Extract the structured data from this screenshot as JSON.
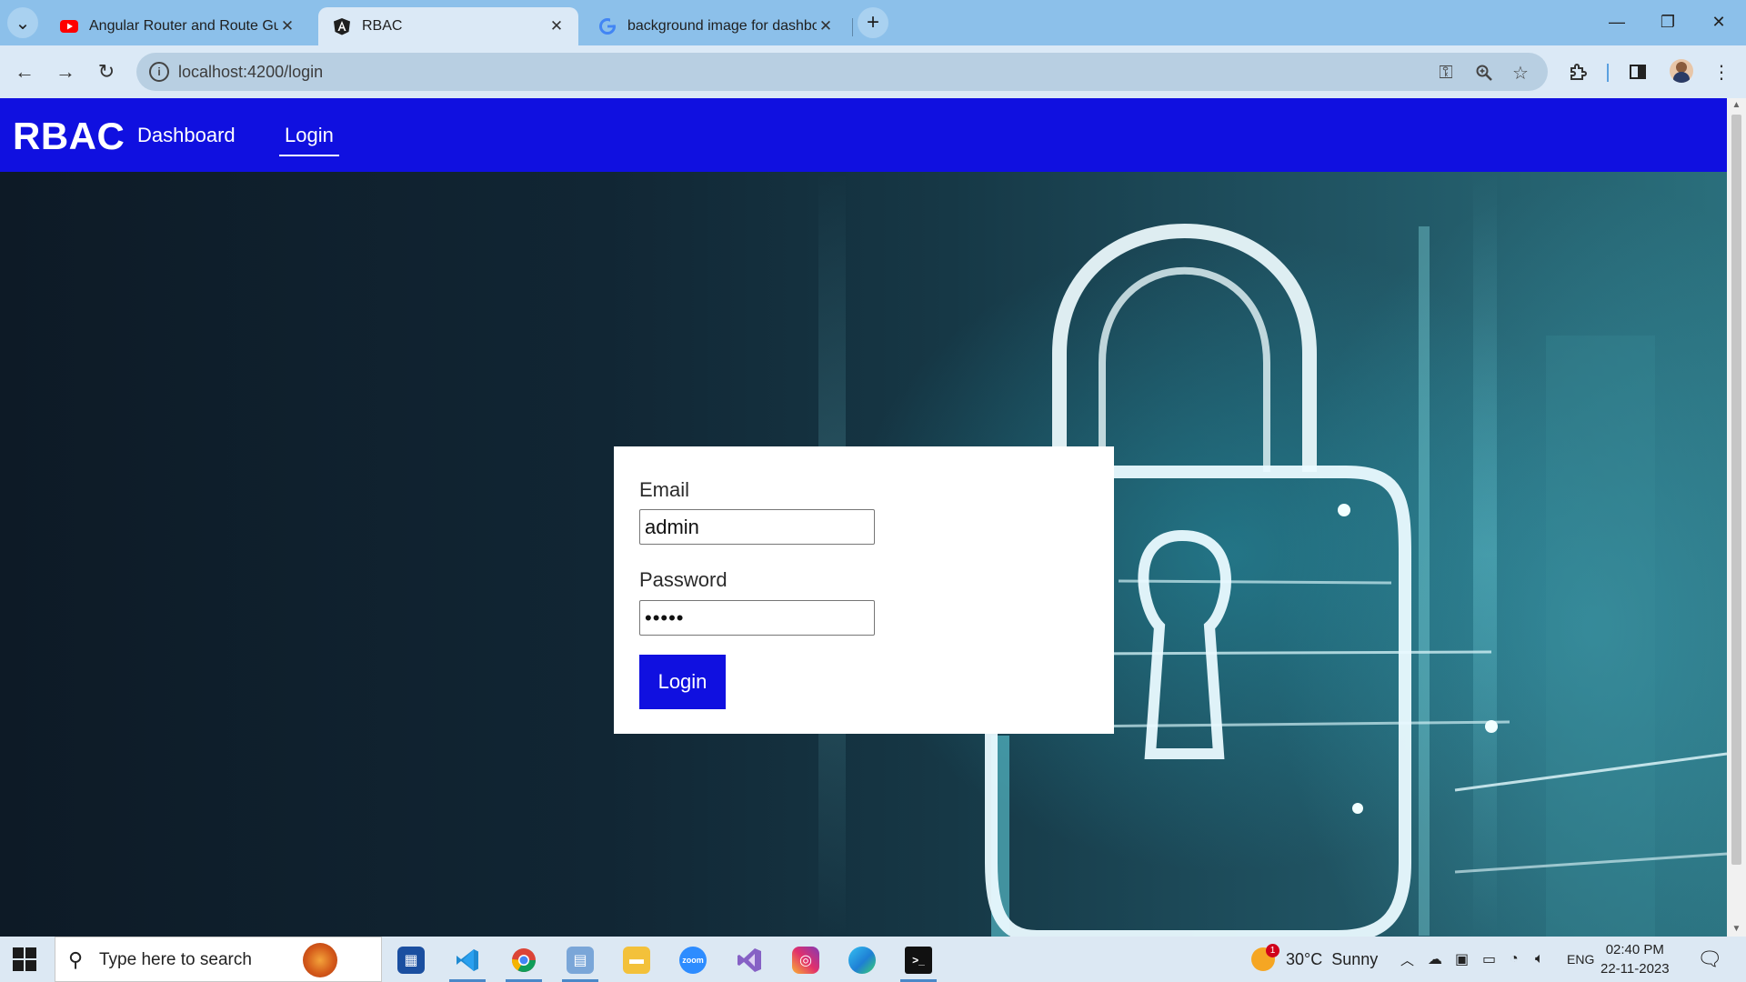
{
  "browser": {
    "tabs": [
      {
        "title": "Angular Router and Route Gua",
        "icon": "youtube-icon",
        "color": "#ff0000"
      },
      {
        "title": "RBAC",
        "icon": "angular-icon",
        "active": true
      },
      {
        "title": "background image for dashbo",
        "icon": "google-icon"
      }
    ],
    "url": "localhost:4200/login"
  },
  "app": {
    "brand": "RBAC",
    "nav": [
      {
        "label": "Dashboard"
      },
      {
        "label": "Login",
        "active": true
      }
    ],
    "accent": "#1010e0"
  },
  "login": {
    "email_label": "Email",
    "email_value": "admin",
    "password_label": "Password",
    "password_value": "•••••",
    "submit_label": "Login"
  },
  "taskbar": {
    "search_placeholder": "Type here to search",
    "weather": "30°C  Sunny",
    "language": "ENG",
    "time": "02:40 PM",
    "date": "22-11-2023",
    "weather_badge": "1"
  }
}
